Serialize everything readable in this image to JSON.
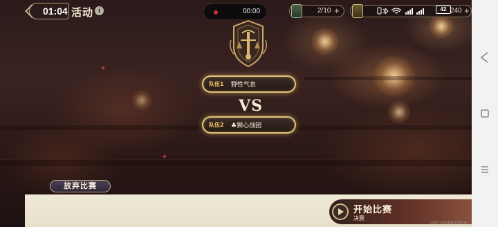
{
  "header": {
    "clock": "01:04",
    "title": "活动",
    "info_icon": "info-icon"
  },
  "recorder": {
    "time": "00:00",
    "dot_color": "#d23232"
  },
  "resources": [
    {
      "icon": "ticket-icon",
      "text": "2/10",
      "plus": "+"
    },
    {
      "icon": "coin-icon",
      "text": "240",
      "plus": "+"
    }
  ],
  "status_bar": {
    "battery": "42"
  },
  "match": {
    "team1_tag": "队伍1",
    "team1_name": "野性气息",
    "vs": "VS",
    "team2_tag": "队伍2",
    "team2_name": "♣狮心战团"
  },
  "actions": {
    "quit_label": "放弃比赛",
    "start_label": "开始比赛",
    "start_sub": "决赛"
  },
  "footer": {
    "uid": "UID 1500021979"
  },
  "colors": {
    "gold_border": "#e3c47a",
    "panel_bg": "#eee8d6"
  }
}
